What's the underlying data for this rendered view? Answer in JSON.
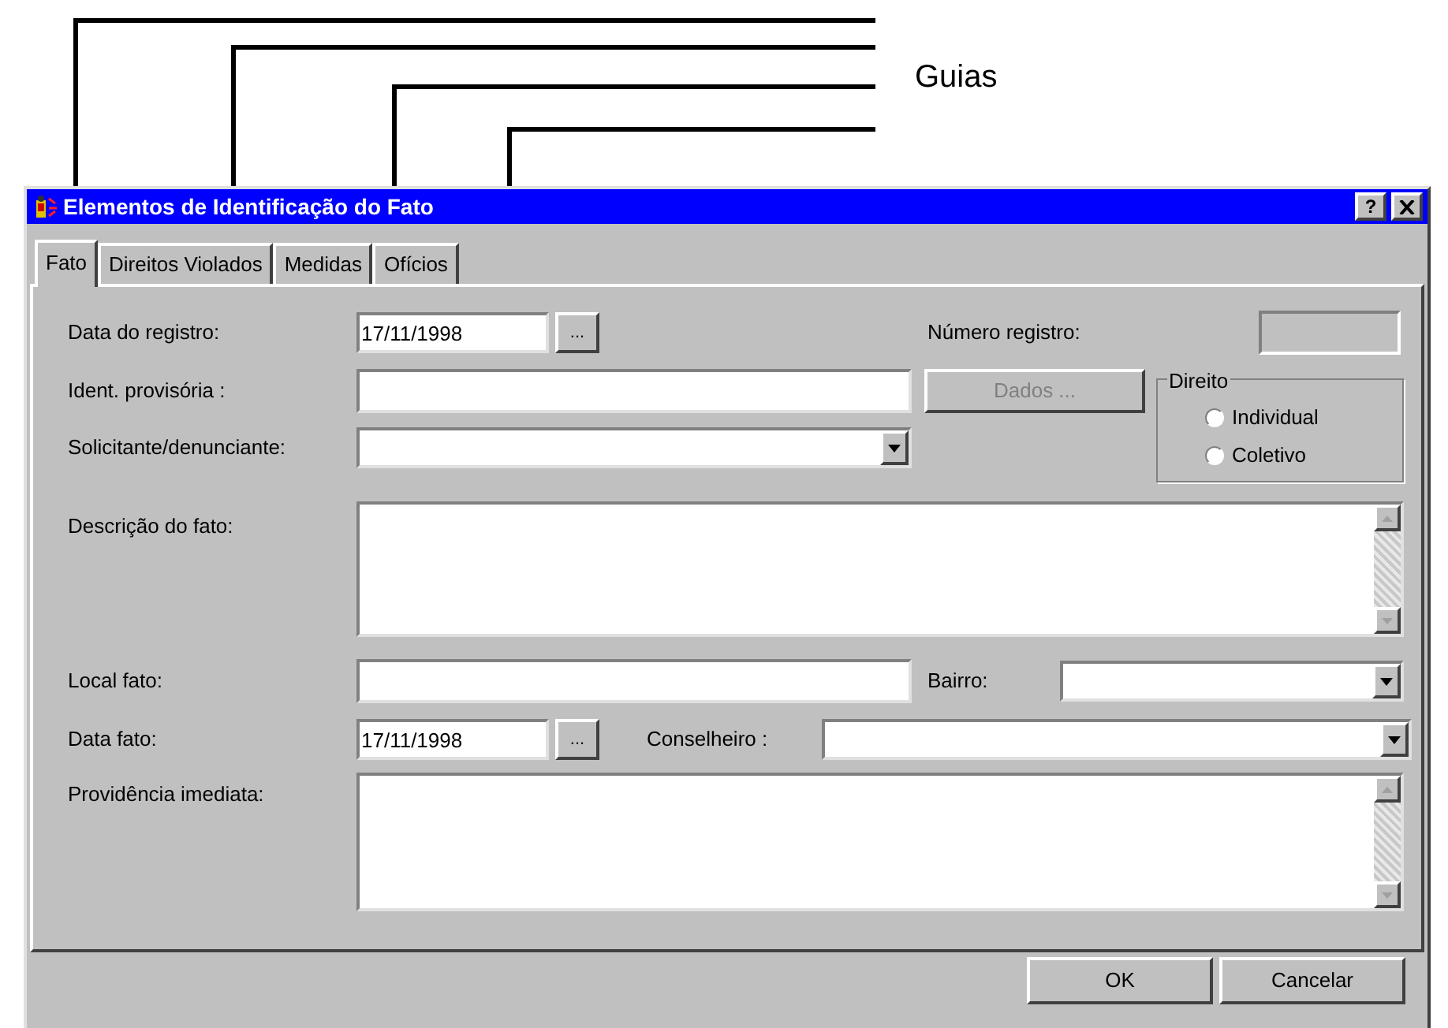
{
  "annotation": {
    "label": "Guias"
  },
  "window": {
    "title": "Elementos de Identificação do Fato",
    "help_button": "?"
  },
  "tabs": [
    {
      "label": "Fato",
      "selected": true
    },
    {
      "label": "Direitos Violados",
      "selected": false
    },
    {
      "label": "Medidas",
      "selected": false
    },
    {
      "label": "Ofícios",
      "selected": false
    }
  ],
  "data_registro": {
    "label": "Data do registro:",
    "value": "17/11/1998",
    "button": "..."
  },
  "numero_registro": {
    "label": "Número registro:"
  },
  "ident_provisoria": {
    "label": "Ident. provisória :"
  },
  "dados_button": {
    "label": "Dados ...",
    "disabled": true
  },
  "direito": {
    "title": "Direito",
    "options": [
      {
        "label": "Individual",
        "selected": false
      },
      {
        "label": "Coletivo",
        "selected": false
      }
    ]
  },
  "solicitante": {
    "label": "Solicitante/denunciante:"
  },
  "descricao": {
    "label": "Descrição do fato:"
  },
  "local_fato": {
    "label": "Local fato:"
  },
  "bairro": {
    "label": "Bairro:"
  },
  "data_fato": {
    "label": "Data fato:",
    "value": "17/11/1998",
    "button": "..."
  },
  "conselheiro": {
    "label": "Conselheiro :"
  },
  "providencia": {
    "label": "Providência imediata:"
  },
  "buttons": [
    "OK",
    "Cancelar"
  ]
}
